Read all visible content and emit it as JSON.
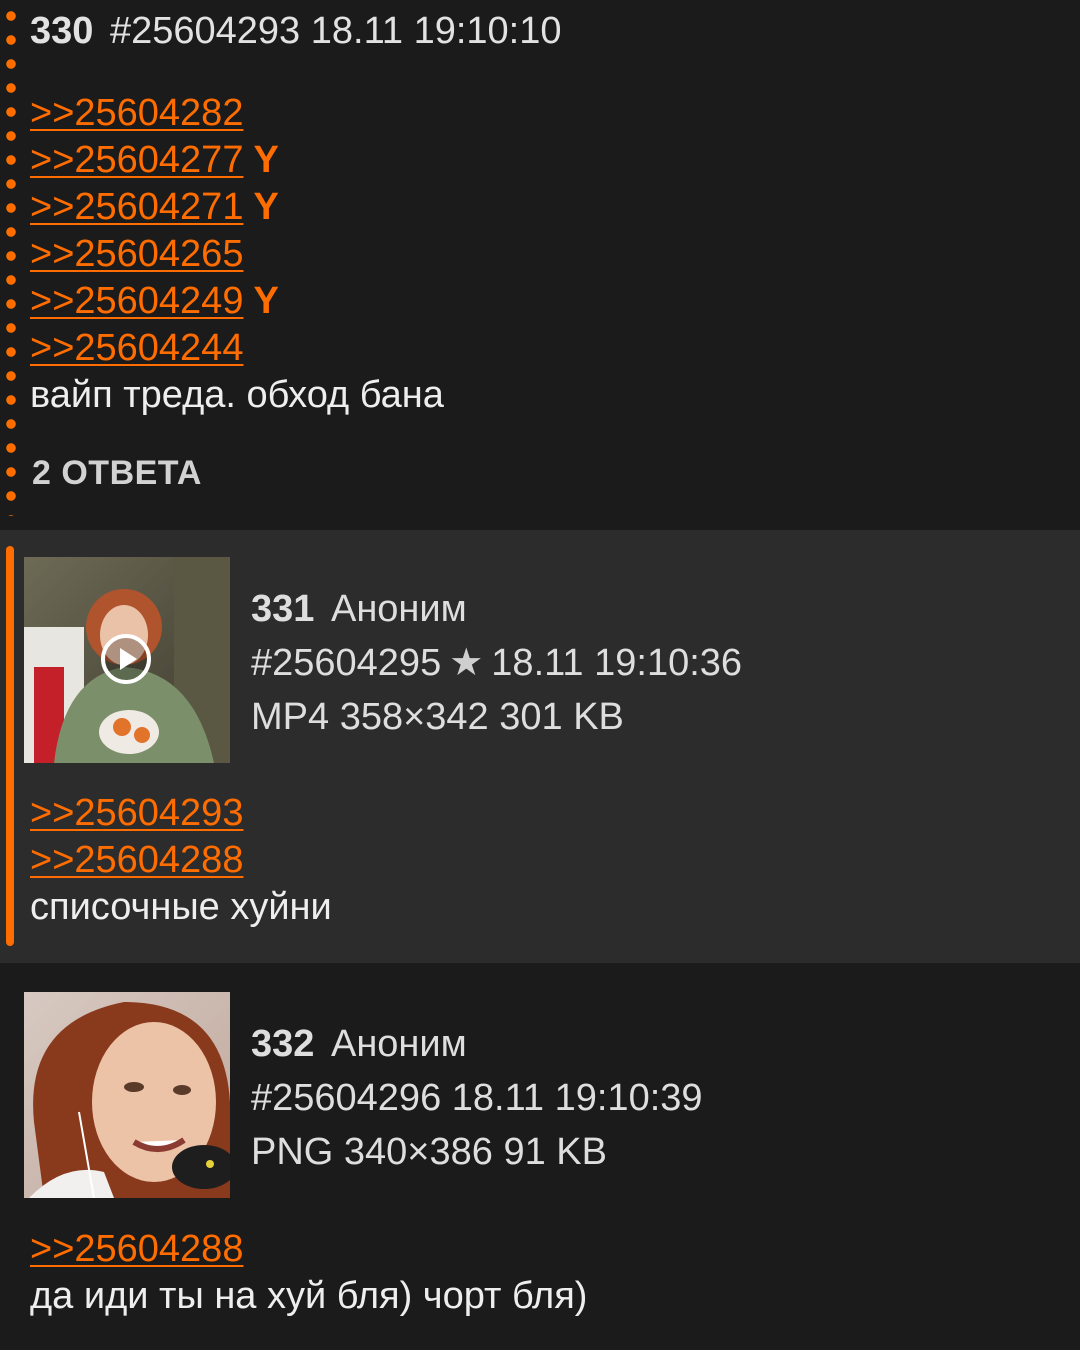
{
  "posts": [
    {
      "index": "330",
      "id": "#25604293",
      "datetime": "18.11 19:10:10",
      "links": [
        {
          "text": ">>25604282",
          "you": ""
        },
        {
          "text": ">>25604277",
          "you": "Y"
        },
        {
          "text": ">>25604271",
          "you": "Y"
        },
        {
          "text": ">>25604265",
          "you": ""
        },
        {
          "text": ">>25604249",
          "you": "Y"
        },
        {
          "text": ">>25604244",
          "you": ""
        }
      ],
      "text": "вайп треда. обход бана",
      "replies": "2 ОТВЕТА"
    },
    {
      "index": "331",
      "name": "Аноним",
      "id": "#25604295",
      "datetime": "18.11 19:10:36",
      "file": "MP4 358×342 301 KB",
      "links": [
        ">>25604293",
        ">>25604288"
      ],
      "text": "списочные хуйни"
    },
    {
      "index": "332",
      "name": "Аноним",
      "id": "#25604296",
      "datetime": "18.11 19:10:39",
      "file": "PNG 340×386 91 KB",
      "links": [
        ">>25604288"
      ],
      "text": "да иди ты на хуй бля) чорт бля)"
    }
  ],
  "colors": {
    "accent": "#ff6d00",
    "background": "#1b1b1b",
    "highlight_post": "#2c2c2c"
  },
  "icons": {
    "video": "play-icon",
    "star": "star-icon"
  }
}
